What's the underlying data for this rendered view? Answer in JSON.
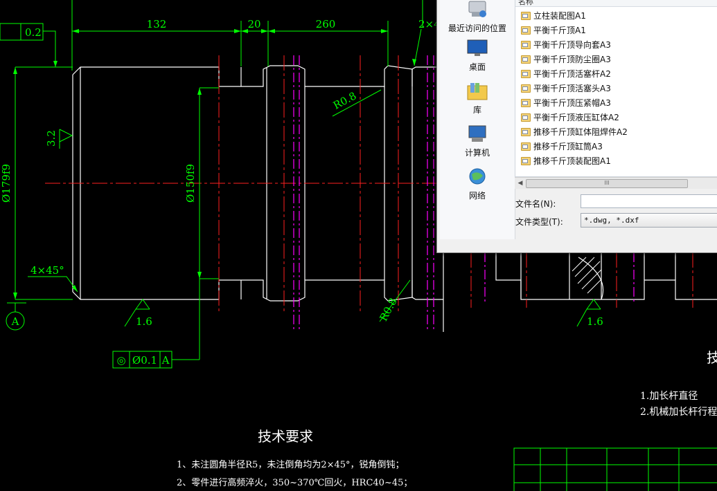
{
  "drawing": {
    "dims": {
      "d132": "132",
      "d20": "20",
      "d260": "260",
      "d2x4": "2×4",
      "tol02": "0.2",
      "diaA": "Ø179f9",
      "diaB": "Ø150f9",
      "ch1": "4×45°",
      "r1": "R0.8",
      "r2": "R0.8",
      "rough1": "3.2",
      "rough2": "1.6",
      "rough3": "1.6"
    },
    "datum_a": "A",
    "tolerance_frame": {
      "c1": "◎",
      "c2": "Ø0.1",
      "c3": "A"
    },
    "tech_title": "技术要求",
    "tech_lines": [
      "1、未注圆角半径R5，未注倒角均为2×45°，锐角倒钝；",
      "2、零件进行高频淬火，350~370℃回火，HRC40~45；"
    ],
    "right_title_partial": "技",
    "right_notes": [
      "1.加长杆直径",
      "2.机械加长杆行程"
    ]
  },
  "dialog": {
    "column_header": "名称",
    "places": [
      "最近访问的位置",
      "桌面",
      "库",
      "计算机",
      "网络"
    ],
    "files": [
      "立柱装配图A1",
      "平衡千斤顶A1",
      "平衡千斤顶导向套A3",
      "平衡千斤顶防尘圈A3",
      "平衡千斤顶活塞杆A2",
      "平衡千斤顶活塞头A3",
      "平衡千斤顶压紧帽A3",
      "平衡千斤顶液压缸体A2",
      "推移千斤顶缸体阻焊件A2",
      "推移千斤顶缸筒A3",
      "推移千斤顶装配图A1"
    ],
    "scroll_thumb": "III",
    "filename_label": "文件名(N):",
    "filename_value": "",
    "filetype_label": "文件类型(T):",
    "filetype_value": "*.dwg, *.dxf"
  },
  "colors": {
    "cad_bg": "#000000",
    "outline": "#ffffff",
    "dimension": "#00ff00",
    "centerline": "#ff0000",
    "construction": "#ff00ff"
  }
}
